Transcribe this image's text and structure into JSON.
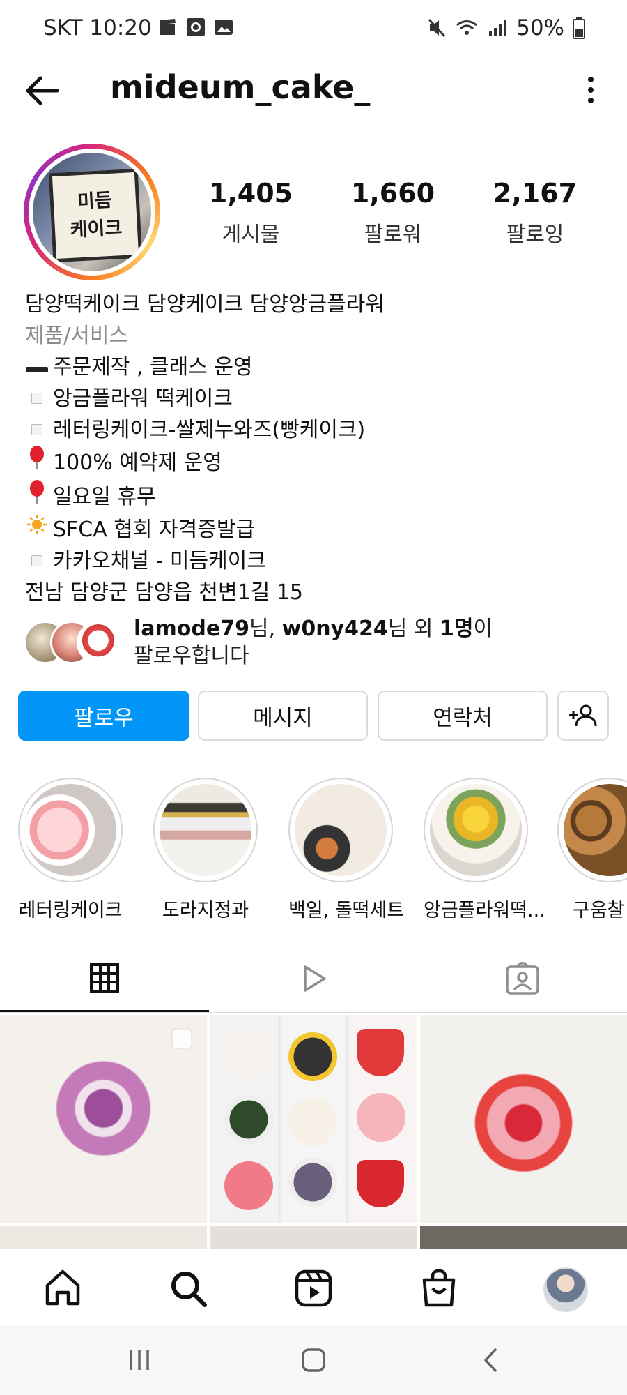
{
  "status_bar": {
    "carrier_time": "SKT 10:20",
    "battery": "50%",
    "left_icons": [
      "clapper-icon",
      "record-icon",
      "gallery-icon"
    ],
    "right_icons": [
      "mute-icon",
      "wifi-icon",
      "signal-icon",
      "battery-icon"
    ]
  },
  "header": {
    "username": "mideum_cake_",
    "back_icon": "arrow-left-icon",
    "menu_icon": "more-vertical-icon"
  },
  "profile": {
    "avatar_sign_line1": "미듬",
    "avatar_sign_line2": "케이크",
    "stats": [
      {
        "value": "1,405",
        "label": "게시물"
      },
      {
        "value": "1,660",
        "label": "팔로워"
      },
      {
        "value": "2,167",
        "label": "팔로잉"
      }
    ]
  },
  "bio": {
    "name": "담양떡케이크 담양케이크 담양앙금플라워",
    "category": "제품/서비스",
    "lines": [
      {
        "icon": "dash-icon",
        "text": "주문제작 , 클래스 운영"
      },
      {
        "icon": "square-icon",
        "text": "앙금플라워 떡케이크"
      },
      {
        "icon": "square-icon",
        "text": "레터링케이크-쌀제누와즈(빵케이크)"
      },
      {
        "icon": "balloon-icon",
        "text": "100% 예약제 운영"
      },
      {
        "icon": "balloon-icon",
        "text": "일요일 휴무"
      },
      {
        "icon": "sun-icon",
        "text": "SFCA 협회 자격증발급"
      },
      {
        "icon": "square-icon",
        "text": "카카오채널 - 미듬케이크"
      }
    ],
    "address": "전남 담양군 담양읍 천변1길 15"
  },
  "followed_by": {
    "user1": "lamode79",
    "sep1": "님, ",
    "user2": "w0ny424",
    "mid": "님 외 ",
    "count": "1명",
    "end": "이",
    "line2": "팔로우합니다"
  },
  "actions": {
    "follow": "팔로우",
    "message": "메시지",
    "contact": "연락처",
    "add_user_icon": "add-user-icon"
  },
  "highlights": [
    {
      "label": "레터링케이크"
    },
    {
      "label": "도라지정과"
    },
    {
      "label": "백일, 돌떡세트"
    },
    {
      "label": "앙금플라워떡..."
    },
    {
      "label": "구움찰"
    }
  ],
  "tabs": [
    "grid-icon",
    "reels-icon",
    "tagged-icon"
  ],
  "bottom_nav": [
    "home-icon",
    "search-icon",
    "reels-icon",
    "shop-icon",
    "profile-avatar"
  ],
  "system_nav": [
    "recent-apps-icon",
    "home-button-icon",
    "back-icon"
  ]
}
